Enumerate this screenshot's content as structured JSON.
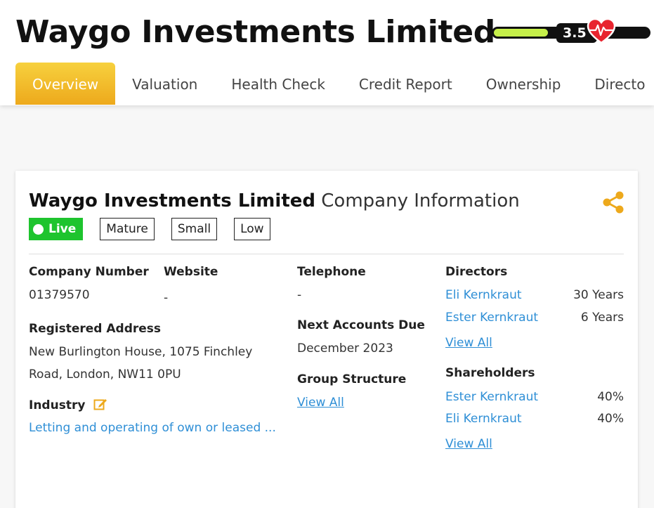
{
  "header": {
    "company_name": "Waygo Investments Limited",
    "health_score": "3.5",
    "health_fraction": 0.35,
    "colors": {
      "accent": "#eda91c",
      "health_fill": "#c6f04a",
      "live": "#1ec42e",
      "link": "#2f8fd6"
    }
  },
  "tabs": [
    {
      "label": "Overview",
      "active": true
    },
    {
      "label": "Valuation"
    },
    {
      "label": "Health Check"
    },
    {
      "label": "Credit Report"
    },
    {
      "label": "Ownership"
    },
    {
      "label": "Directo"
    }
  ],
  "card": {
    "title_bold": "Waygo Investments Limited",
    "title_rest": "Company Information",
    "share_icon": "share-icon",
    "badges": {
      "live": "Live",
      "age": "Mature",
      "size": "Small",
      "risk": "Low"
    },
    "company_number": {
      "label": "Company Number",
      "value": "01379570"
    },
    "website": {
      "label": "Website",
      "value": "-"
    },
    "telephone": {
      "label": "Telephone",
      "value": "-"
    },
    "registered_address": {
      "label": "Registered Address",
      "line1": "New Burlington House, 1075 Finchley",
      "line2": "Road, London, NW11 0PU"
    },
    "industry": {
      "label": "Industry",
      "value": "Letting and operating of own or leased ...",
      "edit_icon": "edit-icon"
    },
    "next_accounts_due": {
      "label": "Next Accounts Due",
      "value": "December 2023"
    },
    "group_structure": {
      "label": "Group Structure",
      "link": "View All"
    },
    "directors": {
      "label": "Directors",
      "items": [
        {
          "name": "Eli Kernkraut",
          "tenure": "30 Years"
        },
        {
          "name": "Ester Kernkraut",
          "tenure": "6 Years"
        }
      ],
      "view_all": "View All"
    },
    "shareholders": {
      "label": "Shareholders",
      "items": [
        {
          "name": "Ester Kernkraut",
          "share": "40%"
        },
        {
          "name": "Eli Kernkraut",
          "share": "40%"
        }
      ],
      "view_all": "View All"
    }
  }
}
